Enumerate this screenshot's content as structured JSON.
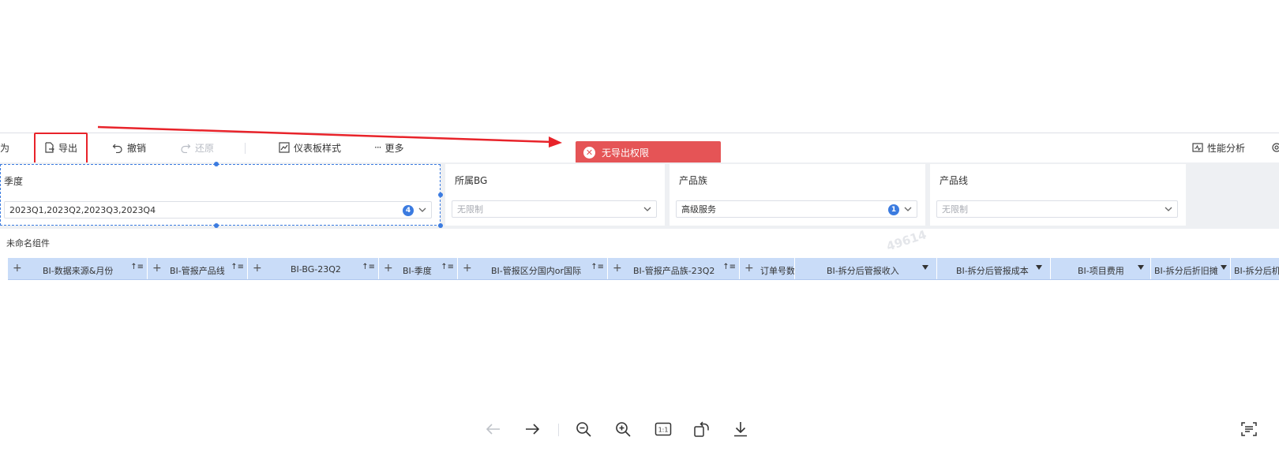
{
  "toolbar": {
    "cut_label": "为",
    "export_label": "导出",
    "undo_label": "撤销",
    "redo_label": "还原",
    "dashboard_style_label": "仪表板样式",
    "more_label": "更多",
    "perf_label": "性能分析"
  },
  "toast": {
    "message": "无导出权限",
    "color": "#e55456"
  },
  "filters": [
    {
      "title": "季度",
      "value": "2023Q1,2023Q2,2023Q3,2023Q4",
      "badge": "4"
    },
    {
      "title": "所属BG",
      "value": "无限制"
    },
    {
      "title": "产品族",
      "value": "高级服务",
      "badge": "1"
    },
    {
      "title": "产品线",
      "value": "无限制"
    }
  ],
  "component": {
    "title": "未命名组件",
    "watermark": "49614",
    "columns": [
      "BI-数据来源&月份",
      "BI-管报产品线",
      "BI-BG-23Q2",
      "BI-季度",
      "BI-管报区分国内or国际",
      "BI-管报产品族-23Q2",
      "订单号数",
      "BI-拆分后管报收入",
      "BI-拆分后管报成本",
      "BI-项目费用",
      "BI-拆分后折旧摊",
      "BI-拆分后机房"
    ]
  },
  "colors": {
    "accent": "#3b7be0",
    "header_bg": "#c9dcf8",
    "highlight": "#e8232a"
  },
  "viewer": {
    "icons": [
      "arrow-left-icon",
      "arrow-right-icon",
      "zoom-out-icon",
      "zoom-in-icon",
      "actual-size-icon",
      "rotate-icon",
      "download-icon",
      "ocr-icon"
    ],
    "actual_size_label": "1:1"
  }
}
